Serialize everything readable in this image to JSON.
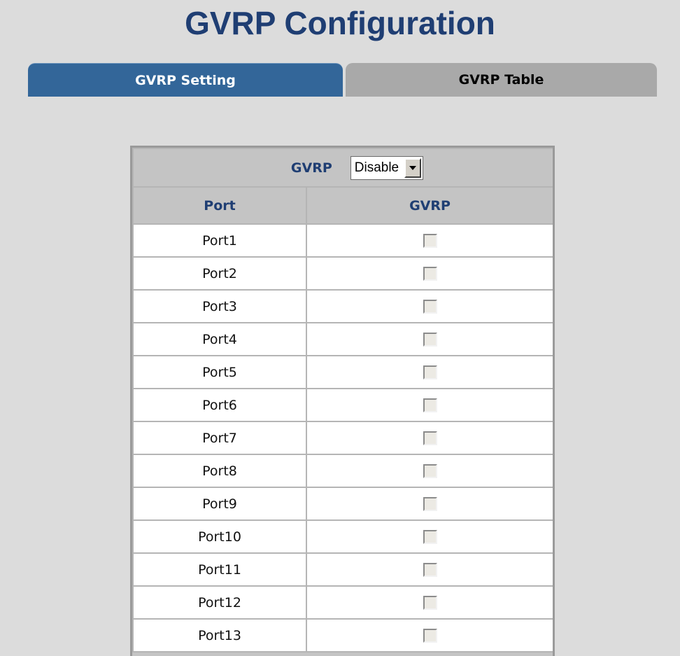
{
  "page": {
    "title": "GVRP Configuration"
  },
  "tabs": [
    {
      "label": "GVRP Setting",
      "active": true
    },
    {
      "label": "GVRP Table",
      "active": false
    }
  ],
  "global": {
    "label": "GVRP",
    "select_value": "Disable"
  },
  "table": {
    "headers": [
      "Port",
      "GVRP"
    ],
    "rows": [
      {
        "port": "Port1",
        "checked": false
      },
      {
        "port": "Port2",
        "checked": false
      },
      {
        "port": "Port3",
        "checked": false
      },
      {
        "port": "Port4",
        "checked": false
      },
      {
        "port": "Port5",
        "checked": false
      },
      {
        "port": "Port6",
        "checked": false
      },
      {
        "port": "Port7",
        "checked": false
      },
      {
        "port": "Port8",
        "checked": false
      },
      {
        "port": "Port9",
        "checked": false
      },
      {
        "port": "Port10",
        "checked": false
      },
      {
        "port": "Port11",
        "checked": false
      },
      {
        "port": "Port12",
        "checked": false
      },
      {
        "port": "Port13",
        "checked": false
      }
    ]
  },
  "colors": {
    "title": "#1f3e73",
    "tab_active": "#336699",
    "tab_inactive": "#a9a9a9",
    "background": "#dcdcdc",
    "table_header": "#c4c4c4"
  }
}
